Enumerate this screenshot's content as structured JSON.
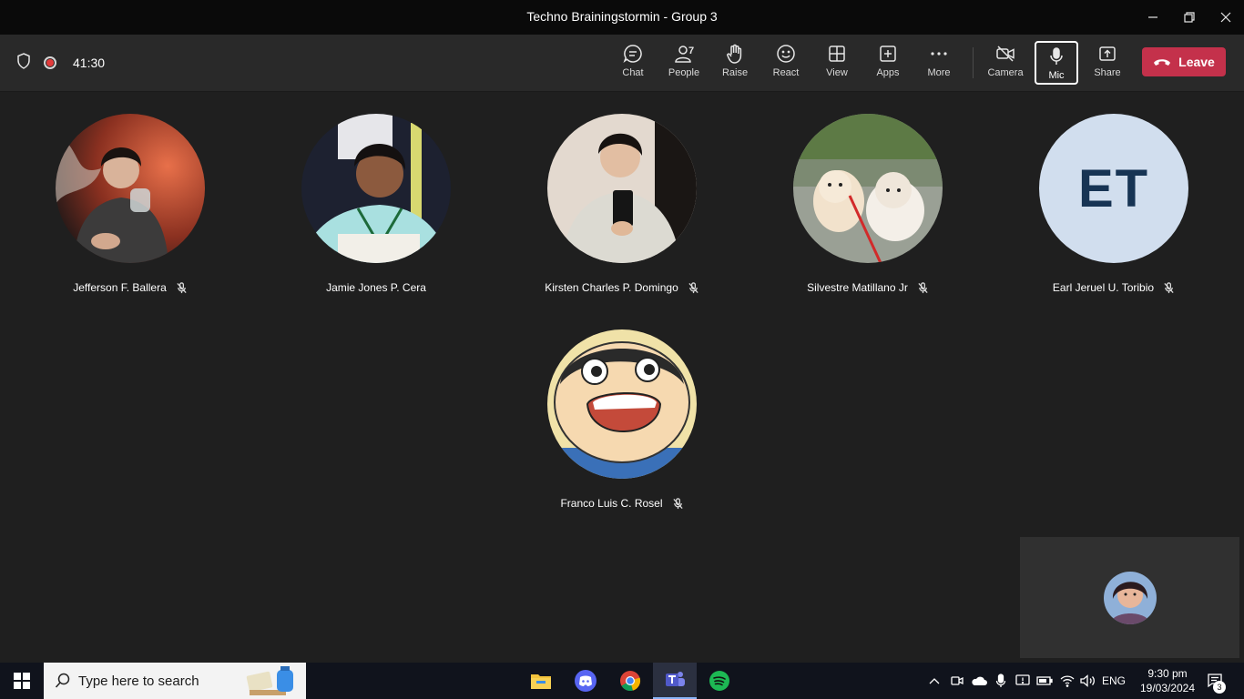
{
  "window": {
    "title": "Techno Brainingstormin - Group 3",
    "controls": [
      "minimize-icon",
      "restore-icon",
      "close-icon"
    ]
  },
  "meeting": {
    "timer": "41:30",
    "toolbar": {
      "chat": "Chat",
      "people": "People",
      "people_count": "7",
      "raise": "Raise",
      "react": "React",
      "view": "View",
      "apps": "Apps",
      "more": "More",
      "camera": "Camera",
      "mic": "Mic",
      "share": "Share",
      "leave": "Leave"
    },
    "participants": [
      {
        "name": "Jefferson F. Ballera",
        "muted": true
      },
      {
        "name": "Jamie Jones P. Cera",
        "muted": false
      },
      {
        "name": "Kirsten Charles P. Domingo",
        "muted": true
      },
      {
        "name": "Silvestre Matillano Jr",
        "muted": true
      },
      {
        "name": "Earl Jeruel U. Toribio",
        "muted": true,
        "initials": "ET"
      },
      {
        "name": "Franco Luis C. Rosel",
        "muted": true
      }
    ]
  },
  "taskbar": {
    "search_placeholder": "Type here to search",
    "apps": [
      "file-explorer-icon",
      "discord-icon",
      "chrome-icon",
      "teams-icon",
      "spotify-icon"
    ],
    "language": "ENG",
    "time": "9:30 pm",
    "date": "19/03/2024",
    "notifications": "3"
  },
  "colors": {
    "background": "#1f1f1f",
    "toolbar": "#292929",
    "leave": "#c4314b",
    "initials_bg": "#d1deee",
    "initials_fg": "#173454"
  }
}
